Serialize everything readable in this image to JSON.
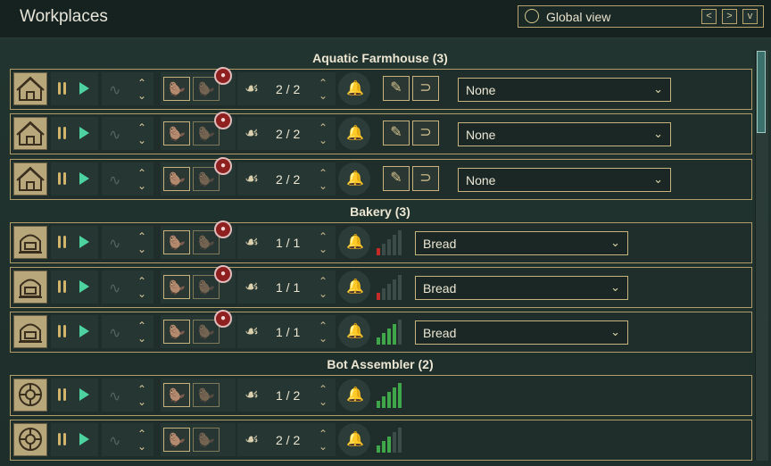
{
  "window": {
    "title": "Workplaces"
  },
  "global_view": {
    "label": "Global view",
    "prev": "<",
    "next": ">",
    "collapse": "v"
  },
  "icons": {
    "pause": "pause-icon",
    "play": "play-icon",
    "priority": "wave-icon",
    "worker": "beaver-icon",
    "lock": "lock-icon",
    "alert": "bell-icon"
  },
  "colors": {
    "play": "#4dd3a0",
    "accent": "#c8b57e",
    "lock": "#8e2020",
    "bar_red": "#c42a28",
    "bar_green": "#3fa64a"
  },
  "groups": [
    {
      "title": "Aquatic Farmhouse (3)",
      "rows": [
        {
          "count": "2 / 2",
          "select": "None",
          "tools": [
            "planting-icon",
            "sickle-icon"
          ]
        },
        {
          "count": "2 / 2",
          "select": "None",
          "tools": [
            "planting-icon",
            "sickle-icon"
          ]
        },
        {
          "count": "2 / 2",
          "select": "None",
          "tools": [
            "planting-icon",
            "sickle-icon"
          ]
        }
      ]
    },
    {
      "title": "Bakery (3)",
      "rows": [
        {
          "count": "1 / 1",
          "select": "Bread",
          "level": 1,
          "level_max": 5,
          "level_color": "red"
        },
        {
          "count": "1 / 1",
          "select": "Bread",
          "level": 1,
          "level_max": 5,
          "level_color": "red"
        },
        {
          "count": "1 / 1",
          "select": "Bread",
          "level": 4,
          "level_max": 5,
          "level_color": "green"
        }
      ]
    },
    {
      "title": "Bot Assembler (2)",
      "rows": [
        {
          "count": "1 / 2",
          "select": null,
          "level": 5,
          "level_max": 5,
          "level_color": "green"
        },
        {
          "count": "2 / 2",
          "select": null,
          "level": 3,
          "level_max": 5,
          "level_color": "green"
        }
      ]
    }
  ]
}
